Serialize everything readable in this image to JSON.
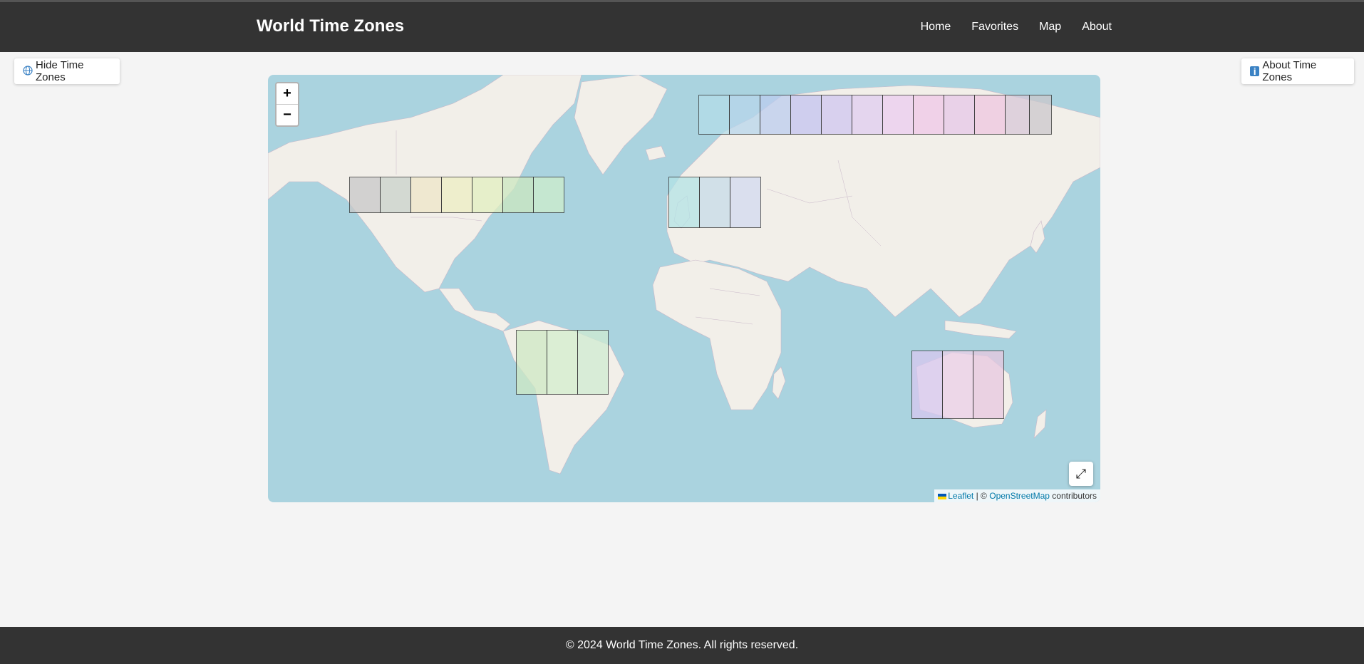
{
  "app": {
    "title": "World Time Zones"
  },
  "nav": {
    "home": "Home",
    "favorites": "Favorites",
    "map": "Map",
    "about": "About"
  },
  "controls": {
    "hide_label": "Hide Time Zones",
    "about_label": "About Time Zones",
    "zoom_in": "+",
    "zoom_out": "−",
    "fullscreen": "⤢"
  },
  "attribution": {
    "leaflet": "Leaflet",
    "separator": "| ©",
    "osm": "OpenStreetMap",
    "suffix": "contributors"
  },
  "footer": {
    "text": "© 2024 World Time Zones. All rights reserved."
  },
  "colors": {
    "header_bg": "#333333",
    "ocean": "#aad3df",
    "land": "#f2efe9",
    "link": "#0078a8"
  },
  "overlay_colors": {
    "north_america": [
      "#c8c8c8",
      "#c9d2cb",
      "#efe6c8",
      "#edeec3",
      "#e2f0c0",
      "#cce8c0",
      "#cfeecb"
    ],
    "europe": [
      "#b4e3e6",
      "#c6dbe8",
      "#d2daf0"
    ],
    "asia": [
      "#b4dde9",
      "#b8d6ec",
      "#bccdef",
      "#c4c4f0",
      "#d0c6f0",
      "#e0cdf0",
      "#eccdf0",
      "#f0c8e8",
      "#e6c8e8",
      "#efc6e0",
      "#d8c8d8",
      "#ccc8cc"
    ],
    "south_america": [
      "#cfe9c4",
      "#d4eecd",
      "#d0ecd2"
    ],
    "australia": [
      "#d8c8f0",
      "#ecd0e8",
      "#e8c8e0"
    ]
  }
}
